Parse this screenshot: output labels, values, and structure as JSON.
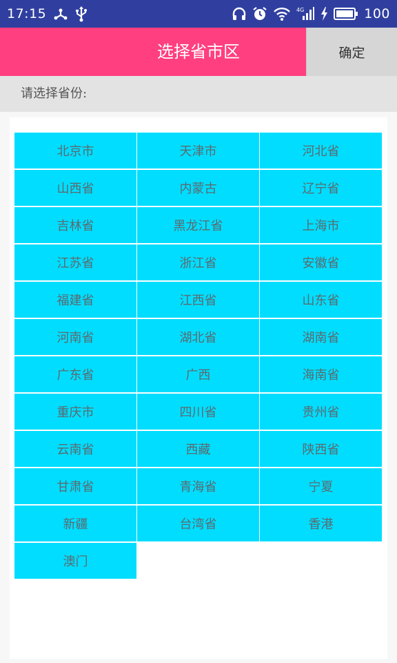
{
  "status_bar": {
    "time": "17:15",
    "left_icons": [
      "usb-debug-icon",
      "usb-icon"
    ],
    "right_icons": [
      "headphones-icon",
      "alarm-icon",
      "wifi-icon",
      "signal-4g-icon",
      "charging-icon",
      "battery-icon"
    ],
    "signal_label": "4G",
    "battery_level": "100",
    "background": "#303f9f"
  },
  "header": {
    "title": "选择省市区",
    "confirm_label": "确定",
    "accent_color": "#ff3f7f"
  },
  "prompt": {
    "label": "请选择省份:"
  },
  "provinces": [
    "北京市",
    "天津市",
    "河北省",
    "山西省",
    "内蒙古",
    "辽宁省",
    "吉林省",
    "黑龙江省",
    "上海市",
    "江苏省",
    "浙江省",
    "安徽省",
    "福建省",
    "江西省",
    "山东省",
    "河南省",
    "湖北省",
    "湖南省",
    "广东省",
    "广西",
    "海南省",
    "重庆市",
    "四川省",
    "贵州省",
    "云南省",
    "西藏",
    "陕西省",
    "甘肃省",
    "青海省",
    "宁夏",
    "新疆",
    "台湾省",
    "香港",
    "澳门"
  ],
  "cell_color": "#00ddff"
}
